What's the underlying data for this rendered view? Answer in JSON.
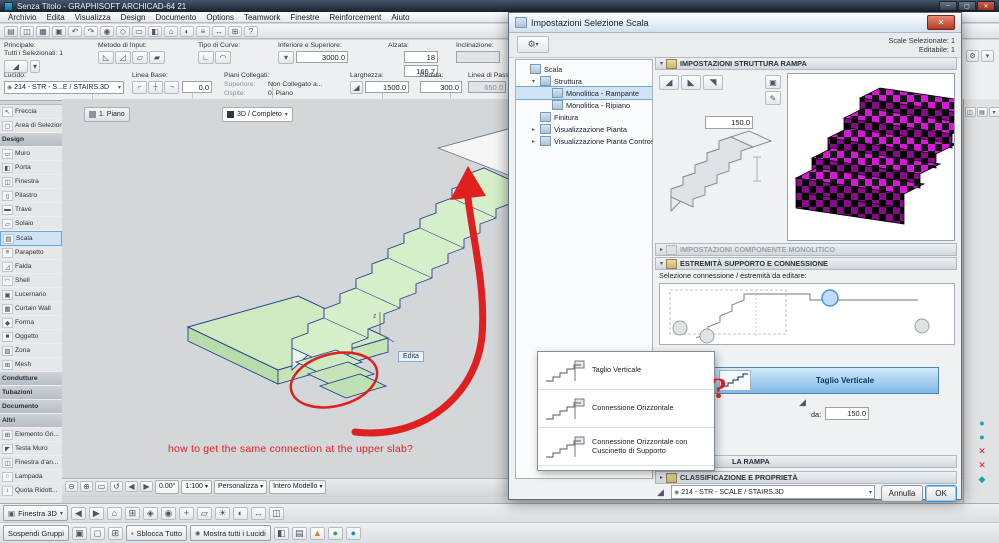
{
  "titlebar": {
    "title": "Senza Titolo - GRAPHISOFT ARCHICAD-64 21"
  },
  "icons": {
    "caret_down": "▾",
    "caret_right": "▸",
    "close": "✕",
    "min": "–",
    "max": "▢",
    "eye": "◉",
    "pen": "✎",
    "gear": "⚙",
    "lock": "▪",
    "cube": "▣",
    "stair": "◢"
  },
  "menu": {
    "items": [
      "Archivio",
      "Edita",
      "Visualizza",
      "Design",
      "Documento",
      "Options",
      "Teamwork",
      "Finestre",
      "Reinforcement",
      "Aiuto"
    ]
  },
  "toolbar": {
    "icons": [
      {
        "name": "new-file-icon",
        "glyph": "▤"
      },
      {
        "name": "open-file-icon",
        "glyph": "◫"
      },
      {
        "name": "save-icon",
        "glyph": "▦"
      },
      {
        "name": "print-icon",
        "glyph": "▣"
      },
      {
        "name": "undo-icon",
        "glyph": "↶"
      },
      {
        "name": "redo-icon",
        "glyph": "↷"
      },
      {
        "name": "find-select-icon",
        "glyph": "◉"
      },
      {
        "name": "options-icon",
        "glyph": "◇"
      },
      {
        "name": "wall-tool-icon",
        "glyph": "▭"
      },
      {
        "name": "door-tool-icon",
        "glyph": "◧"
      },
      {
        "name": "home-story-icon",
        "glyph": "⌂"
      },
      {
        "name": "render-icon",
        "glyph": "◐"
      },
      {
        "name": "layers-icon",
        "glyph": "≡"
      },
      {
        "name": "fit-window-icon",
        "glyph": "↔"
      },
      {
        "name": "teamwork-icon",
        "glyph": "⊞"
      },
      {
        "name": "help-icon",
        "glyph": "?"
      }
    ]
  },
  "infobox": {
    "principale": {
      "label": "Principale:",
      "selection": "Tutti i Selezionati: 1"
    },
    "metodo": {
      "label": "Metodo di Input:",
      "icons": [
        {
          "name": "input-method-riser-icon",
          "glyph": "◺"
        },
        {
          "name": "input-method-flight-icon",
          "glyph": "◿"
        },
        {
          "name": "input-method-landing-icon",
          "glyph": "▱"
        },
        {
          "name": "input-method-full-icon",
          "glyph": "▰"
        }
      ]
    },
    "tipo": {
      "label": "Tipo di Curve:",
      "icons": [
        {
          "name": "curve-straight-icon",
          "glyph": "∟"
        },
        {
          "name": "curve-arc-icon",
          "glyph": "◠"
        }
      ]
    },
    "interiore": {
      "label": "Inferiore e Superiore:",
      "value": "3000.0"
    },
    "alzata": {
      "label": "Alzata:",
      "count": "18",
      "riser": "166.7"
    },
    "inclinazione": {
      "label": "Inclinazione:"
    },
    "lucido": {
      "label": "Lucido:",
      "value": "214 - STR - S...E / STAIRS.3D"
    },
    "linea_base": {
      "label": "Linea Base:",
      "value": "0.0",
      "icons": [
        {
          "name": "baseline-left-icon",
          "glyph": "⌐"
        },
        {
          "name": "baseline-center-icon",
          "glyph": "┼"
        },
        {
          "name": "baseline-right-icon",
          "glyph": "¬"
        }
      ]
    },
    "piani": {
      "label": "Piani Collegati:",
      "sup_label": "Superiore:",
      "sup_value": "Non Collegato a...",
      "host_label": "Ospite:",
      "host_value": "0. Piano"
    },
    "larghezza": {
      "label": "Larghezza:",
      "value": "1500.0"
    },
    "pedata": {
      "label": "Pedata:",
      "value": "300.0"
    },
    "linea_passo": {
      "label": "Linea di Passo:",
      "value": "650.0"
    }
  },
  "toolbox": {
    "items": [
      {
        "label": "Freccia",
        "icon": "↖"
      },
      {
        "label": "Area di Selezione",
        "icon": "▢"
      },
      {
        "label": "Design",
        "type": "header"
      },
      {
        "label": "Muro",
        "icon": "▭"
      },
      {
        "label": "Porta",
        "icon": "◧"
      },
      {
        "label": "Finestra",
        "icon": "◫"
      },
      {
        "label": "Pilastro",
        "icon": "▯"
      },
      {
        "label": "Trave",
        "icon": "▬"
      },
      {
        "label": "Solaio",
        "icon": "▱"
      },
      {
        "label": "Scala",
        "icon": "▤",
        "state": "selected"
      },
      {
        "label": "Parapetto",
        "icon": "≡"
      },
      {
        "label": "Falda",
        "icon": "◿"
      },
      {
        "label": "Shell",
        "icon": "◠"
      },
      {
        "label": "Lucernario",
        "icon": "▣"
      },
      {
        "label": "Curtain Wall",
        "icon": "▦"
      },
      {
        "label": "Forma",
        "icon": "◆"
      },
      {
        "label": "Oggetto",
        "icon": "■"
      },
      {
        "label": "Zona",
        "icon": "▨"
      },
      {
        "label": "Mesh",
        "icon": "⊞"
      },
      {
        "label": "Condutture",
        "type": "header"
      },
      {
        "label": "Tubazioni",
        "type": "header"
      },
      {
        "label": "Documento",
        "type": "header"
      },
      {
        "label": "Altri",
        "type": "header"
      },
      {
        "label": "Elemento Gri...",
        "icon": "⊞"
      },
      {
        "label": "Testa Muro",
        "icon": "◤"
      },
      {
        "label": "Finestra d'an...",
        "icon": "◫"
      },
      {
        "label": "Lampada",
        "icon": "○"
      },
      {
        "label": "Quota Ridott...",
        "icon": "↕"
      }
    ]
  },
  "viewport": {
    "tabs": {
      "plan": "1. Piano",
      "threed": "3D / Completo"
    },
    "edita_tip": "Edita",
    "annotation": "how to get the same connection at the upper slab?",
    "question_mark": "?",
    "axis_label": "z",
    "zoombar": {
      "icons": [
        {
          "name": "zoom-out-icon",
          "glyph": "⊖"
        },
        {
          "name": "zoom-in-icon",
          "glyph": "⊕"
        },
        {
          "name": "fit-view-icon",
          "glyph": "▭"
        },
        {
          "name": "orbit-icon",
          "glyph": "↺"
        },
        {
          "name": "prev-view-icon",
          "glyph": "◀"
        },
        {
          "name": "next-view-icon",
          "glyph": "▶"
        }
      ],
      "angle": "0.00°",
      "scale": "1:100",
      "zoom_mode": "Personalizza",
      "view_mode": "Intero Modello"
    }
  },
  "right_panel": {
    "icons": [
      {
        "name": "notify-teal-1-icon",
        "glyph": "●",
        "color": "#17a2b2"
      },
      {
        "name": "notify-teal-2-icon",
        "glyph": "●",
        "color": "#17a2b2"
      },
      {
        "name": "error-1-icon",
        "glyph": "✕",
        "color": "#d42222"
      },
      {
        "name": "error-2-icon",
        "glyph": "✕",
        "color": "#d42222"
      },
      {
        "name": "notify-diamond-icon",
        "glyph": "◆",
        "color": "#17a2b2"
      }
    ],
    "top_icons": [
      {
        "name": "panel-window-icon",
        "glyph": "◫"
      },
      {
        "name": "panel-list-icon",
        "glyph": "▤"
      },
      {
        "name": "panel-caret-icon",
        "glyph": "▾"
      }
    ]
  },
  "statusbar": {
    "window_label": "Finestra 3D",
    "row1_icons": [
      {
        "name": "nav-back-icon",
        "glyph": "◀"
      },
      {
        "name": "nav-fwd-icon",
        "glyph": "▶"
      },
      {
        "name": "home-icon",
        "glyph": "⌂"
      },
      {
        "name": "grid-snap-icon",
        "glyph": "⊞"
      },
      {
        "name": "guides-icon",
        "glyph": "◈"
      },
      {
        "name": "gravity-icon",
        "glyph": "◉"
      },
      {
        "name": "cursor-snap-icon",
        "glyph": "+"
      },
      {
        "name": "edit-plane-icon",
        "glyph": "▱"
      },
      {
        "name": "sun-icon",
        "glyph": "☀"
      },
      {
        "name": "camera-icon",
        "glyph": "◐"
      },
      {
        "name": "ruler-icon",
        "glyph": "↔"
      },
      {
        "name": "trace-icon",
        "glyph": "◫"
      }
    ],
    "suspend_groups": "Sospendi Gruppi",
    "row2_icons": [
      {
        "name": "group-icon",
        "glyph": "▣"
      },
      {
        "name": "ungroup-icon",
        "glyph": "◻"
      },
      {
        "name": "autogroup-icon",
        "glyph": "⊞"
      }
    ],
    "unlock_all": "Sblocca Tutto",
    "show_layers": "Mostra tutti i Lucidi",
    "row2_icons_b": [
      {
        "name": "renovation-icon",
        "glyph": "◧"
      },
      {
        "name": "filter-icon",
        "glyph": "▤"
      },
      {
        "name": "warning-icon",
        "glyph": "▲",
        "color": "#e0821a"
      },
      {
        "name": "status-green-icon",
        "glyph": "●",
        "color": "#2aa84a"
      },
      {
        "name": "status-blue-icon",
        "glyph": "●",
        "color": "#1a8ac0"
      }
    ]
  },
  "dialog": {
    "title": "Impostazioni Selezione Scala",
    "selected_info": "Scale Selezionate: 1",
    "editable_info": "Editabile: 1",
    "tree_items": [
      {
        "label": "Scala",
        "indent": 4
      },
      {
        "label": "Struttura",
        "indent": 14,
        "expander": "▾"
      },
      {
        "label": "Monolitica - Rampante",
        "indent": 26,
        "state": "selected"
      },
      {
        "label": "Monolitica - Ripiano",
        "indent": 26
      },
      {
        "label": "Finitura",
        "indent": 14
      },
      {
        "label": "Visualizzazione Pianta",
        "indent": 14,
        "expander": "▸"
      },
      {
        "label": "Visualizzazione Pianta Controsoffitto",
        "indent": 14,
        "expander": "▸"
      }
    ],
    "sections": {
      "structure": "IMPOSTAZIONI STRUTTURA RAMPA",
      "component": "IMPOSTAZIONI COMPONENTE MONOLITICO",
      "support": "ESTREMITÀ SUPPORTO E CONNESSIONE",
      "ramp": "LA RAMPA",
      "classification": "CLASSIFICAZIONE E PROPRIETÀ"
    },
    "structure": {
      "thickness": "150.0",
      "type_icons": [
        {
          "name": "stair-structure-1-icon",
          "glyph": "◢"
        },
        {
          "name": "stair-structure-2-icon",
          "glyph": "◣"
        },
        {
          "name": "stair-structure-3-icon",
          "glyph": "◥"
        }
      ]
    },
    "support": {
      "label": "Selezione connessione / estremità da editare:",
      "options": [
        {
          "label": "Taglio Verticale"
        },
        {
          "label": "Connessione Orizzontale"
        },
        {
          "label": "Connessione Orizzontale con Cuscinetto di Supporto"
        }
      ],
      "selected_option": "Taglio Verticale",
      "da_label": "da:",
      "da_value": "150.0"
    },
    "footer": {
      "layer": "214 - STR - SCALE / STAIRS.3D",
      "cancel": "Annulla",
      "ok": "OK"
    }
  },
  "colors": {
    "annotation_red": "#e01f1f",
    "stair_green": "#d6eec9",
    "preview_magenta": "#d818d8",
    "selection_blue": "#7fb8e6"
  }
}
